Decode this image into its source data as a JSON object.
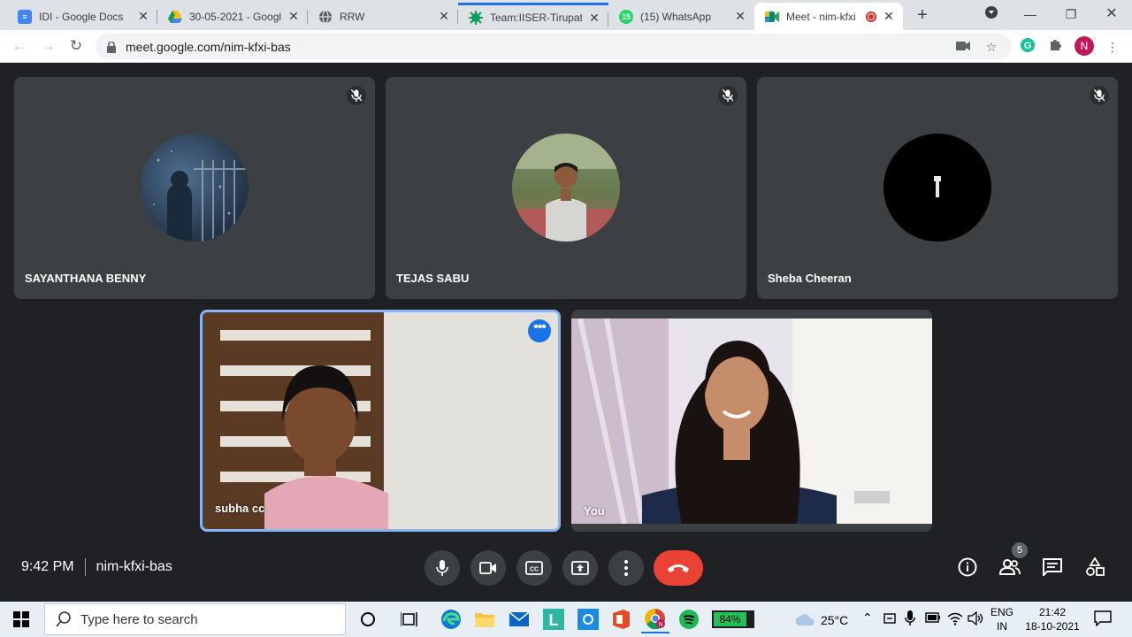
{
  "browser": {
    "tabs": [
      {
        "title": "IDI - Google Docs",
        "icon": "google-docs-icon",
        "color": "#4285f4"
      },
      {
        "title": "30-05-2021 - Googl",
        "icon": "google-drive-icon",
        "color": "#fbbc04"
      },
      {
        "title": "RRW",
        "icon": "globe-icon",
        "color": "#5f6368"
      },
      {
        "title": "Team:IISER-Tirupati",
        "icon": "igem-icon",
        "color": "#0f9d58"
      },
      {
        "title": "(15) WhatsApp",
        "icon": "whatsapp-icon",
        "color": "#25d366",
        "badge": "15"
      },
      {
        "title": "Meet - nim-kfxi",
        "icon": "google-meet-icon",
        "color": "#00897b",
        "active": true,
        "recording": true
      }
    ],
    "new_tab": "+",
    "url": "meet.google.com/nim-kfxi-bas",
    "profile_initial": "N"
  },
  "meet": {
    "participants": [
      {
        "name": "SAYANTHANA BENNY",
        "muted": true
      },
      {
        "name": "TEJAS SABU",
        "muted": true
      },
      {
        "name": "Sheba Cheeran",
        "muted": true
      }
    ],
    "video_tiles": [
      {
        "name": "subha cc",
        "active_speaker": true
      },
      {
        "name": "You",
        "active_speaker": false
      }
    ],
    "time": "9:42 PM",
    "meeting_code": "nim-kfxi-bas",
    "people_count": "5",
    "accent_color": "#1a73e8",
    "hangup_color": "#ea4335"
  },
  "taskbar": {
    "search_placeholder": "Type here to search",
    "battery": "84%",
    "weather": "25°C",
    "lang_top": "ENG",
    "lang_bottom": "IN",
    "clock_time": "21:42",
    "clock_date": "18-10-2021"
  }
}
